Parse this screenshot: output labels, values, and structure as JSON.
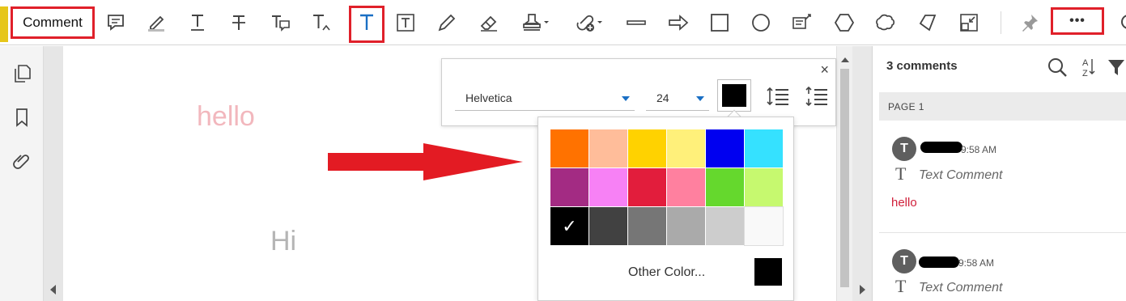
{
  "toolbar": {
    "comment_label": "Comment",
    "tools": [
      {
        "name": "sticky-note-icon"
      },
      {
        "name": "highlight-icon"
      },
      {
        "name": "underline-text-icon"
      },
      {
        "name": "strikethrough-icon"
      },
      {
        "name": "replace-text-icon"
      },
      {
        "name": "insert-text-icon"
      },
      {
        "name": "add-text-comment-icon"
      },
      {
        "name": "text-box-icon"
      },
      {
        "name": "pencil-icon"
      },
      {
        "name": "eraser-icon"
      },
      {
        "name": "stamp-icon"
      },
      {
        "name": "attach-file-icon"
      },
      {
        "name": "line-icon"
      },
      {
        "name": "arrow-icon"
      },
      {
        "name": "rectangle-icon"
      },
      {
        "name": "oval-icon"
      },
      {
        "name": "text-callout-icon"
      },
      {
        "name": "polygon-icon"
      },
      {
        "name": "cloud-icon"
      },
      {
        "name": "polygon-line-icon"
      },
      {
        "name": "shrink-icon"
      },
      {
        "name": "pin-icon"
      }
    ],
    "more_label": "•••",
    "highlight_color": "#e0202a"
  },
  "left_rail": {
    "icons": [
      "pages-icon",
      "bookmark-icon",
      "attachment-icon"
    ]
  },
  "document": {
    "hello_text": "hello",
    "hi_text": "Hi",
    "hello_color": "#f2b7bd",
    "hi_color": "#b5b5b5",
    "arrow_color": "#e31b23"
  },
  "text_properties": {
    "close_label": "×",
    "font": "Helvetica",
    "size": "24",
    "current_color": "#000000"
  },
  "palette": {
    "colors": [
      "#ff7200",
      "#ffbd9a",
      "#ffd200",
      "#fff07a",
      "#0000f0",
      "#35e1ff",
      "#a32b83",
      "#f781f5",
      "#e21d3c",
      "#ff809f",
      "#65d82d",
      "#c6f96f",
      "#000000",
      "#414141",
      "#767676",
      "#aaaaaa",
      "#cdcdcd",
      "#f9f9f9"
    ],
    "selected_index": 12,
    "check_mark": "✓",
    "other_color_label": "Other Color...",
    "other_color_value": "#000000"
  },
  "comments_panel": {
    "count_label": "3 comments",
    "page_label": "PAGE 1",
    "comments": [
      {
        "avatar": "T",
        "time": "9:58 AM",
        "type_icon": "T",
        "type_label": "Text Comment",
        "body": "hello"
      },
      {
        "avatar": "T",
        "time": "9:58 AM",
        "type_icon": "T",
        "type_label": "Text Comment",
        "body": ""
      }
    ]
  }
}
